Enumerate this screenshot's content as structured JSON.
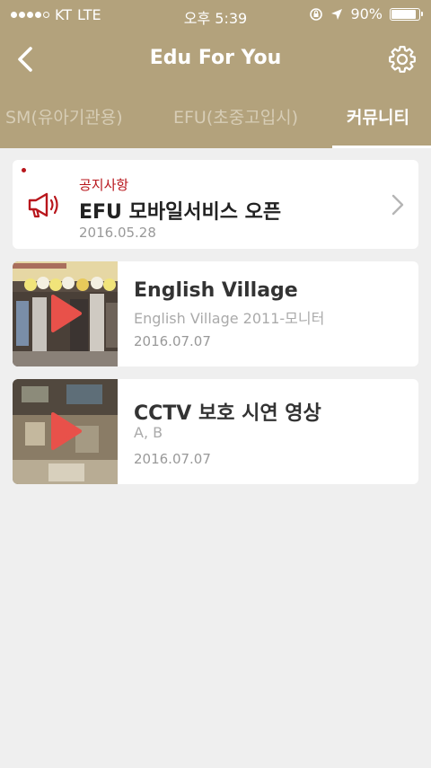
{
  "status_bar": {
    "carrier": "KT",
    "network": "LTE",
    "time": "오후 5:39",
    "battery": "90%",
    "battery_level": 0.9
  },
  "nav": {
    "title": "Edu For You",
    "back_icon": "chevron-left-icon",
    "settings_icon": "gear-icon"
  },
  "tabs": [
    {
      "label": "SM(유아기관용)",
      "active": false
    },
    {
      "label": "EFU(초중고입시)",
      "active": false
    },
    {
      "label": "커뮤니티",
      "active": true
    }
  ],
  "notice": {
    "tag": "공지사항",
    "title": "EFU 모바일서비스 오픈",
    "date": "2016.05.28",
    "icon": "megaphone-icon"
  },
  "videos": [
    {
      "title": "English Village",
      "subtitle": "English Village 2011-모니터",
      "date": "2016.07.07"
    },
    {
      "title": "CCTV 보호 시연 영상",
      "subtitle": "A, B",
      "date": "2016.07.07"
    }
  ],
  "colors": {
    "header": "#b3a27c",
    "accent_red": "#b8161c",
    "play": "#e8514a",
    "background": "#efefef"
  }
}
